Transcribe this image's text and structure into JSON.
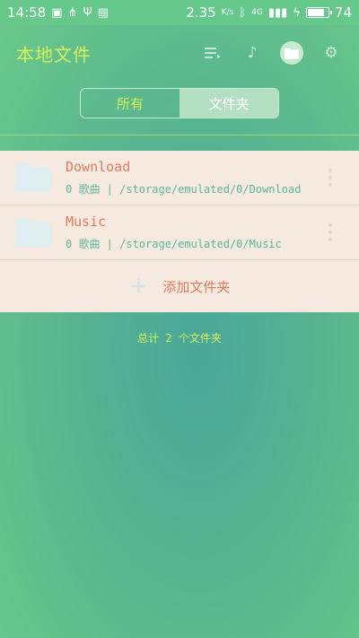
{
  "status": {
    "time": "14:58",
    "speed": "2.35",
    "speed_unit": "K/s",
    "signal": "4G",
    "battery": "74"
  },
  "appbar": {
    "title": "本地文件"
  },
  "segments": {
    "all": "所有",
    "folders": "文件夹"
  },
  "folders": [
    {
      "name": "Download",
      "subtitle": "0 歌曲 | /storage/emulated/0/Download"
    },
    {
      "name": "Music",
      "subtitle": "0 歌曲 | /storage/emulated/0/Music"
    }
  ],
  "add_folder_label": "添加文件夹",
  "summary": "总计 2 个文件夹",
  "colors": {
    "accent": "#d6f05a",
    "item_title": "#e07c5c",
    "item_subtitle": "#5eb59b",
    "list_bg": "#f6e9e0"
  }
}
